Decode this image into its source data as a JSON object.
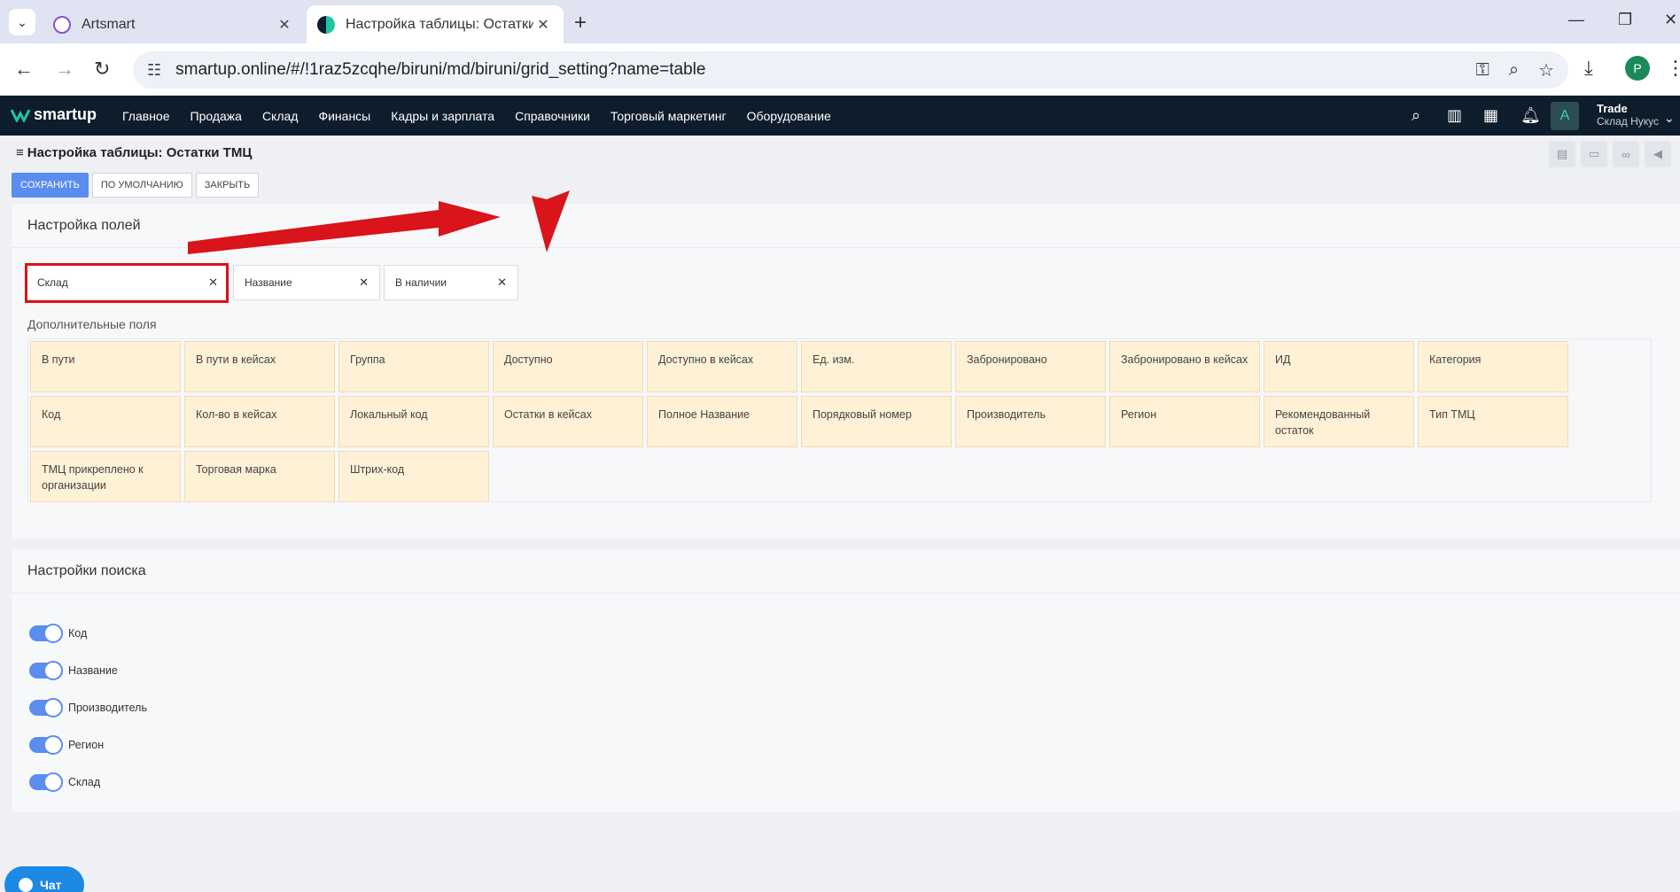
{
  "browser": {
    "tabs": [
      {
        "title": "Artsmart",
        "active": false
      },
      {
        "title": "Настройка таблицы: Остатки Т",
        "active": true
      }
    ],
    "url": "smartup.online/#/!1raz5zcqhe/biruni/md/biruni/grid_setting?name=table",
    "profile_initial": "P"
  },
  "app": {
    "logo_text": "smartup",
    "menu": [
      "Главное",
      "Продажа",
      "Склад",
      "Финансы",
      "Кадры и зарплата",
      "Справочники",
      "Торговый маркетинг",
      "Оборудование"
    ],
    "avatar_letter": "A",
    "user_line1": "Trade",
    "user_line2": "Склад Нукус"
  },
  "page": {
    "title": "Настройка таблицы: Остатки ТМЦ",
    "buttons": {
      "save": "Сохранить",
      "default": "По умолчанию",
      "close": "Закрыть"
    }
  },
  "fields_panel": {
    "title": "Настройка полей",
    "selected": [
      "Склад",
      "Название",
      "В наличии"
    ],
    "extra_label": "Дополнительные поля",
    "extra": [
      "В пути",
      "В пути в кейсах",
      "Группа",
      "Доступно",
      "Доступно в кейсах",
      "Ед. изм.",
      "Забронировано",
      "Забронировано в кейсах",
      "ИД",
      "Категория",
      "Код",
      "Кол-во в кейсах",
      "Локальный код",
      "Остатки в кейсах",
      "Полное Название",
      "Порядковый номер",
      "Производитель",
      "Регион",
      "Рекомендованный остаток",
      "Тип ТМЦ",
      "ТМЦ прикреплено к организации",
      "Торговая марка",
      "Штрих-код"
    ]
  },
  "search_panel": {
    "title": "Настройки поиска",
    "toggles": [
      {
        "label": "Код",
        "on": true
      },
      {
        "label": "Название",
        "on": true
      },
      {
        "label": "Производитель",
        "on": true
      },
      {
        "label": "Регион",
        "on": true
      },
      {
        "label": "Склад",
        "on": true
      }
    ]
  },
  "chat": {
    "label": "Чат"
  },
  "colors": {
    "accent": "#5b8def",
    "nav_bg": "#0e1d2b",
    "chip_bg": "#fef1d6",
    "highlight": "#d9141a"
  }
}
